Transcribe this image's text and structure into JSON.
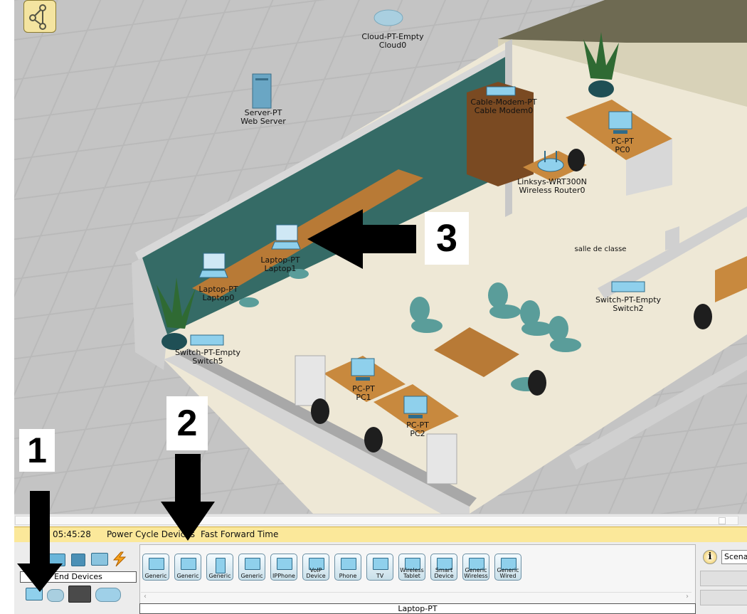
{
  "workspace": {
    "labels": {
      "cloud": [
        "Cloud-PT-Empty",
        "Cloud0"
      ],
      "server": [
        "Server-PT",
        "Web Server"
      ],
      "modem": [
        "Cable-Modem-PT",
        "Cable Modem0"
      ],
      "pc0": [
        "PC-PT",
        "PC0"
      ],
      "router": [
        "Linksys-WRT300N",
        "Wireless Router0"
      ],
      "room": [
        "salle de classe"
      ],
      "laptop1": [
        "Laptop-PT",
        "Laptop1"
      ],
      "laptop0": [
        "Laptop-PT",
        "Laptop0"
      ],
      "switch2": [
        "Switch-PT-Empty",
        "Switch2"
      ],
      "switch5": [
        "Switch-PT-Empty",
        "Switch5"
      ],
      "pc1": [
        "PC-PT",
        "PC1"
      ],
      "pc2": [
        "PC-PT",
        "PC2"
      ]
    }
  },
  "annotations": {
    "one": "1",
    "two": "2",
    "three": "3"
  },
  "timebar": {
    "time": "05:45:28",
    "power_cycle": "Power Cycle Devices",
    "fast_forward": "Fast Forward Time"
  },
  "category": {
    "selected_label": "End Devices"
  },
  "devices": [
    {
      "label": "Generic"
    },
    {
      "label": "Generic"
    },
    {
      "label": "Generic"
    },
    {
      "label": "Generic"
    },
    {
      "label": "IPPhone"
    },
    {
      "label": "VoIP Device"
    },
    {
      "label": "Phone"
    },
    {
      "label": "TV"
    },
    {
      "label": "Wireless Tablet"
    },
    {
      "label": "Smart Device"
    },
    {
      "label": "Generic Wireless"
    },
    {
      "label": "Generic Wired"
    }
  ],
  "selected_device": "Laptop-PT",
  "right_panel": {
    "info_glyph": "i",
    "scenario": "Scena"
  },
  "strip_scroll": {
    "left": "‹",
    "right": "›"
  }
}
